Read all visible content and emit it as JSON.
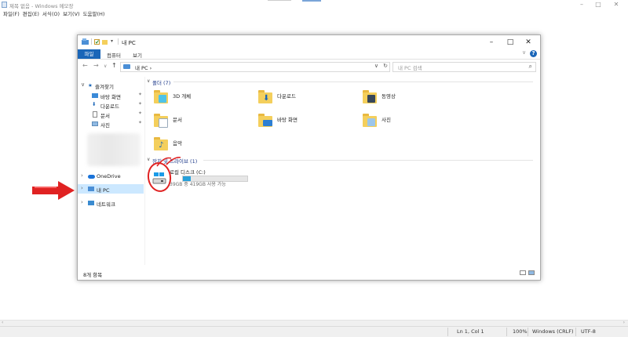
{
  "notepad": {
    "title": "제목 없음 - Windows 메모장",
    "menu": [
      "파일(F)",
      "편집(E)",
      "서식(O)",
      "보기(V)",
      "도움말(H)"
    ],
    "status": {
      "position": "Ln 1, Col 1",
      "zoom": "100%",
      "line_ending": "Windows (CRLF)",
      "encoding": "UTF-8"
    }
  },
  "explorer": {
    "title": "내 PC",
    "ribbon_tabs": [
      "파일",
      "컴퓨터",
      "보기"
    ],
    "address": "내 PC  ›",
    "search_placeholder": "내 PC 검색",
    "nav": {
      "quick_access": "즐겨찾기",
      "quick_items": [
        "바탕 화면",
        "다운로드",
        "문서",
        "사진"
      ],
      "onedrive": "OneDrive",
      "this_pc": "내 PC",
      "network": "네트워크"
    },
    "folders_header": "폴더 (7)",
    "folders": [
      "3D 개체",
      "다운로드",
      "동영상",
      "문서",
      "바탕 화면",
      "사진",
      "음악"
    ],
    "drives_header": "장치 및 드라이브 (1)",
    "drive": {
      "name": "로컬 디스크 (C:)",
      "free_text": "39GB 중 419GB 사용 가능",
      "used_fraction": 0.12
    },
    "status": "8개 항목"
  },
  "colors": {
    "accent": "#1a66b8",
    "selection": "#cce8ff",
    "annotation_red": "#e02222",
    "folder_yellow": "#f4cf5c"
  }
}
